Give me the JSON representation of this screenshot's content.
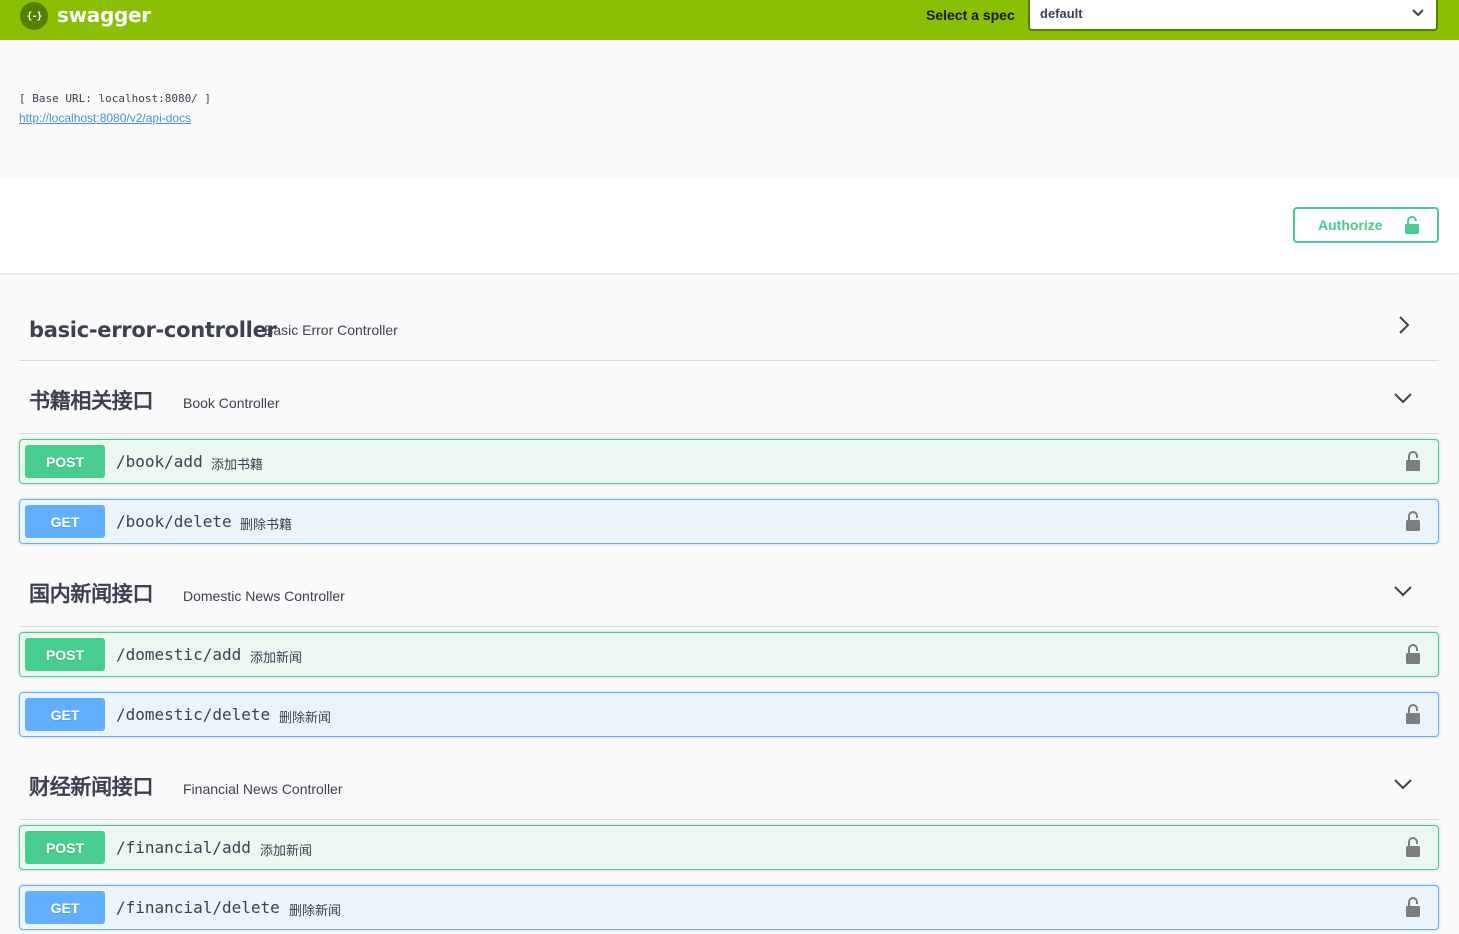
{
  "topbar": {
    "logo_glyph": "{-}",
    "logo_text": "swagger",
    "spec_label": "Select a spec",
    "spec_value": "default"
  },
  "info": {
    "base_url": "[ Base URL: localhost:8080/ ]",
    "api_docs_link": "http://localhost:8080/v2/api-docs"
  },
  "scheme": {
    "authorize_label": "Authorize"
  },
  "tags": [
    {
      "name": "basic-error-controller",
      "description": "Basic Error Controller",
      "expanded": false,
      "operations": []
    },
    {
      "name": "书籍相关接口",
      "description": "Book Controller",
      "expanded": true,
      "operations": [
        {
          "method": "POST",
          "path": "/book/add",
          "summary": "添加书籍"
        },
        {
          "method": "GET",
          "path": "/book/delete",
          "summary": "删除书籍"
        }
      ]
    },
    {
      "name": "国内新闻接口",
      "description": "Domestic News Controller",
      "expanded": true,
      "operations": [
        {
          "method": "POST",
          "path": "/domestic/add",
          "summary": "添加新闻"
        },
        {
          "method": "GET",
          "path": "/domestic/delete",
          "summary": "删除新闻"
        }
      ]
    },
    {
      "name": "财经新闻接口",
      "description": "Financial News Controller",
      "expanded": true,
      "operations": [
        {
          "method": "POST",
          "path": "/financial/add",
          "summary": "添加新闻"
        },
        {
          "method": "GET",
          "path": "/financial/delete",
          "summary": "删除新闻"
        }
      ]
    }
  ],
  "colors": {
    "topbar": "#89bf04",
    "post": "#49cc90",
    "get": "#61affe",
    "authorize": "#49cc90",
    "link": "#4990e2"
  },
  "icons": {
    "logo": "swagger-logo-icon",
    "select": "chevron-down-icon",
    "authorize": "lock-icon",
    "tag_collapsed": "chevron-right-icon",
    "tag_expanded": "chevron-down-icon",
    "operation": "unlocked-lock-icon"
  }
}
